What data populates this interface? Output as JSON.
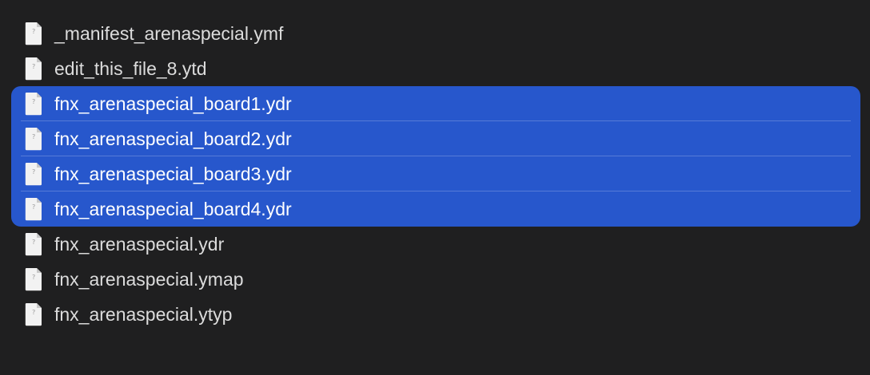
{
  "files": [
    {
      "name": "_manifest_arenaspecial.ymf",
      "selected": false,
      "icon": "document-icon"
    },
    {
      "name": "edit_this_file_8.ytd",
      "selected": false,
      "icon": "document-icon"
    },
    {
      "name": "fnx_arenaspecial_board1.ydr",
      "selected": true,
      "icon": "document-icon"
    },
    {
      "name": "fnx_arenaspecial_board2.ydr",
      "selected": true,
      "icon": "document-icon"
    },
    {
      "name": "fnx_arenaspecial_board3.ydr",
      "selected": true,
      "icon": "document-icon"
    },
    {
      "name": "fnx_arenaspecial_board4.ydr",
      "selected": true,
      "icon": "document-icon"
    },
    {
      "name": "fnx_arenaspecial.ydr",
      "selected": false,
      "icon": "document-icon"
    },
    {
      "name": "fnx_arenaspecial.ymap",
      "selected": false,
      "icon": "document-icon"
    },
    {
      "name": "fnx_arenaspecial.ytyp",
      "selected": false,
      "icon": "document-icon"
    }
  ],
  "colors": {
    "background": "#1f1f20",
    "selection": "#2757cc",
    "text": "#dcdcdc",
    "selected_text": "#ffffff"
  }
}
